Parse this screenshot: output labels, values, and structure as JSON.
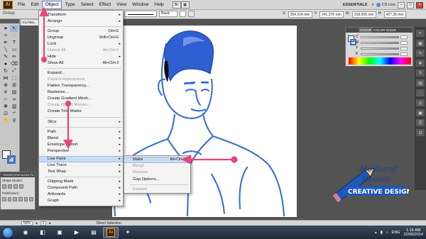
{
  "menubar": {
    "logo": "Ai",
    "items": [
      "File",
      "Edit",
      "Object",
      "Type",
      "Select",
      "Effect",
      "View",
      "Window",
      "Help"
    ],
    "active_item": "Object",
    "workspace": "ESSENTIALS",
    "cs_live": "CS Live"
  },
  "controlbar": {
    "group_label": "Group",
    "brush_preset": "Basic",
    "x_label": "X:",
    "x_value": "254.104 mm",
    "y_label": "Y:",
    "y_value": "241.376 mm",
    "w_label": "W:",
    "w_value": "318.965 mm",
    "h_label": "H:",
    "h_value": "427.35 mm"
  },
  "document_tab": {
    "label": "my blea..."
  },
  "object_menu": {
    "items": [
      {
        "label": "Transform",
        "shortcut": "",
        "submenu": true,
        "disabled": false
      },
      {
        "label": "Arrange",
        "shortcut": "",
        "submenu": true,
        "disabled": false
      },
      {
        "label": "Group",
        "shortcut": "Ctrl+G",
        "submenu": false,
        "disabled": false
      },
      {
        "label": "Ungroup",
        "shortcut": "Shift+Ctrl+G",
        "submenu": false,
        "disabled": false
      },
      {
        "label": "Lock",
        "shortcut": "",
        "submenu": true,
        "disabled": false
      },
      {
        "label": "Unlock All",
        "shortcut": "Alt+Ctrl+2",
        "submenu": false,
        "disabled": true
      },
      {
        "label": "Hide",
        "shortcut": "",
        "submenu": true,
        "disabled": false
      },
      {
        "label": "Show All",
        "shortcut": "Alt+Ctrl+3",
        "submenu": false,
        "disabled": false
      },
      {
        "label": "Expand...",
        "shortcut": "",
        "submenu": false,
        "disabled": false
      },
      {
        "label": "Expand Appearance",
        "shortcut": "",
        "submenu": false,
        "disabled": true
      },
      {
        "label": "Flatten Transparency...",
        "shortcut": "",
        "submenu": false,
        "disabled": false
      },
      {
        "label": "Rasterize...",
        "shortcut": "",
        "submenu": false,
        "disabled": false
      },
      {
        "label": "Create Gradient Mesh...",
        "shortcut": "",
        "submenu": false,
        "disabled": false
      },
      {
        "label": "Create Object Mosaic...",
        "shortcut": "",
        "submenu": false,
        "disabled": true
      },
      {
        "label": "Create Trim Marks",
        "shortcut": "",
        "submenu": false,
        "disabled": false
      },
      {
        "label": "Slice",
        "shortcut": "",
        "submenu": true,
        "disabled": false
      },
      {
        "label": "Path",
        "shortcut": "",
        "submenu": true,
        "disabled": false
      },
      {
        "label": "Blend",
        "shortcut": "",
        "submenu": true,
        "disabled": false
      },
      {
        "label": "Envelope Distort",
        "shortcut": "",
        "submenu": true,
        "disabled": false
      },
      {
        "label": "Perspective",
        "shortcut": "",
        "submenu": true,
        "disabled": false
      },
      {
        "label": "Live Paint",
        "shortcut": "",
        "submenu": true,
        "disabled": false
      },
      {
        "label": "Live Trace",
        "shortcut": "",
        "submenu": true,
        "disabled": false
      },
      {
        "label": "Text Wrap",
        "shortcut": "",
        "submenu": true,
        "disabled": false
      },
      {
        "label": "Clipping Mask",
        "shortcut": "",
        "submenu": true,
        "disabled": false
      },
      {
        "label": "Compound Path",
        "shortcut": "",
        "submenu": true,
        "disabled": false
      },
      {
        "label": "Artboards",
        "shortcut": "",
        "submenu": true,
        "disabled": false
      },
      {
        "label": "Graph",
        "shortcut": "",
        "submenu": true,
        "disabled": false
      }
    ],
    "highlighted": "Live Paint"
  },
  "live_paint_submenu": {
    "items": [
      {
        "label": "Make",
        "shortcut": "Alt+Ctrl+X",
        "disabled": false
      },
      {
        "label": "Merge",
        "shortcut": "",
        "disabled": true
      },
      {
        "label": "Release",
        "shortcut": "",
        "disabled": true
      },
      {
        "label": "Gap Options...",
        "shortcut": "",
        "disabled": false
      },
      {
        "label": "Expand",
        "shortcut": "",
        "disabled": true
      }
    ],
    "highlighted": "Make"
  },
  "color_panel": {
    "tab_color": "COLOR",
    "tab_guide": "COLOR GUIDE",
    "sliders": [
      "C",
      "M",
      "Y",
      "K"
    ]
  },
  "transform_panel": {
    "tabs": "TRANSFORM ALIGN PA",
    "shape_modes": "Shape Modes:",
    "pathfinders": "Pathfinders:"
  },
  "statusbar": {
    "zoom": "50%",
    "page": "1",
    "tool": "Direct Selection"
  },
  "taskbar": {
    "lang": "ENG",
    "time": "1:16 AM",
    "date": "22/09/2014"
  },
  "watermark": {
    "line1": "Mosharaf",
    "line2": "Hossain",
    "line3": "CREATIVE DESIGN"
  },
  "colors": {
    "accent_blue": "#3d6fd3",
    "annotation_pink": "#e8457a",
    "menu_highlight": "#c7dbf4"
  }
}
